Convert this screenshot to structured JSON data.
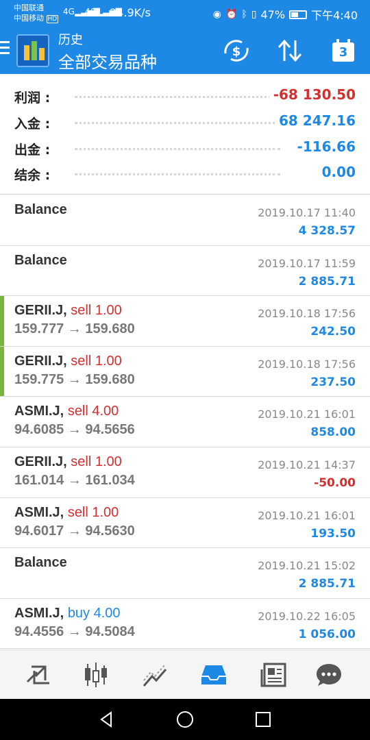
{
  "status_bar": {
    "carrier1": "中国联通",
    "carrier2": "中国移动",
    "hd": "HD",
    "sig1": "4G",
    "sig2": "4G",
    "net_speed": "24.9K/s",
    "battery": "47%",
    "time": "下午4:40"
  },
  "appbar": {
    "subtitle": "历史",
    "title": "全部交易品种",
    "calendar_day": "3"
  },
  "summary": {
    "profit_label": "利润 :",
    "profit_value": "-68 130.50",
    "deposit_label": "入金 :",
    "deposit_value": "68 247.16",
    "withdraw_label": "出金 :",
    "withdraw_value": "-116.66",
    "balance_label": "结余 :",
    "balance_value": "0.00"
  },
  "deals": [
    {
      "symbol": "Balance",
      "action": "",
      "prices": "",
      "date": "2019.10.17 11:40",
      "profit": "4 328.57"
    },
    {
      "symbol": "Balance",
      "action": "",
      "prices": "",
      "date": "2019.10.17 11:59",
      "profit": "2 885.71"
    },
    {
      "symbol": "GERII.J,",
      "action": "sell 1.00",
      "prices": "159.777 → 159.680",
      "date": "2019.10.18 17:56",
      "profit": "242.50"
    },
    {
      "symbol": "GERII.J,",
      "action": "sell 1.00",
      "prices": "159.775 → 159.680",
      "date": "2019.10.18 17:56",
      "profit": "237.50"
    },
    {
      "symbol": "ASMI.J,",
      "action": "sell 4.00",
      "prices": "94.6085 → 94.5656",
      "date": "2019.10.21 16:01",
      "profit": "858.00"
    },
    {
      "symbol": "GERII.J,",
      "action": "sell 1.00",
      "prices": "161.014 → 161.034",
      "date": "2019.10.21 14:37",
      "profit": "-50.00"
    },
    {
      "symbol": "ASMI.J,",
      "action": "sell 1.00",
      "prices": "94.6017 → 94.5630",
      "date": "2019.10.21 16:01",
      "profit": "193.50"
    },
    {
      "symbol": "Balance",
      "action": "",
      "prices": "",
      "date": "2019.10.21 15:02",
      "profit": "2 885.71"
    },
    {
      "symbol": "ASMI.J,",
      "action": "buy 4.00",
      "prices": "94.4556 → 94.5084",
      "date": "2019.10.22 16:05",
      "profit": "1 056.00"
    }
  ],
  "colors": {
    "primary": "#1e88e5",
    "sell": "#d32f2f",
    "buy": "#1e88e5",
    "accent_bar": "#7cb342"
  },
  "bottom_nav": [
    "quotes-icon",
    "chart-icon",
    "trade-icon",
    "history-icon",
    "news-icon",
    "chat-icon"
  ]
}
